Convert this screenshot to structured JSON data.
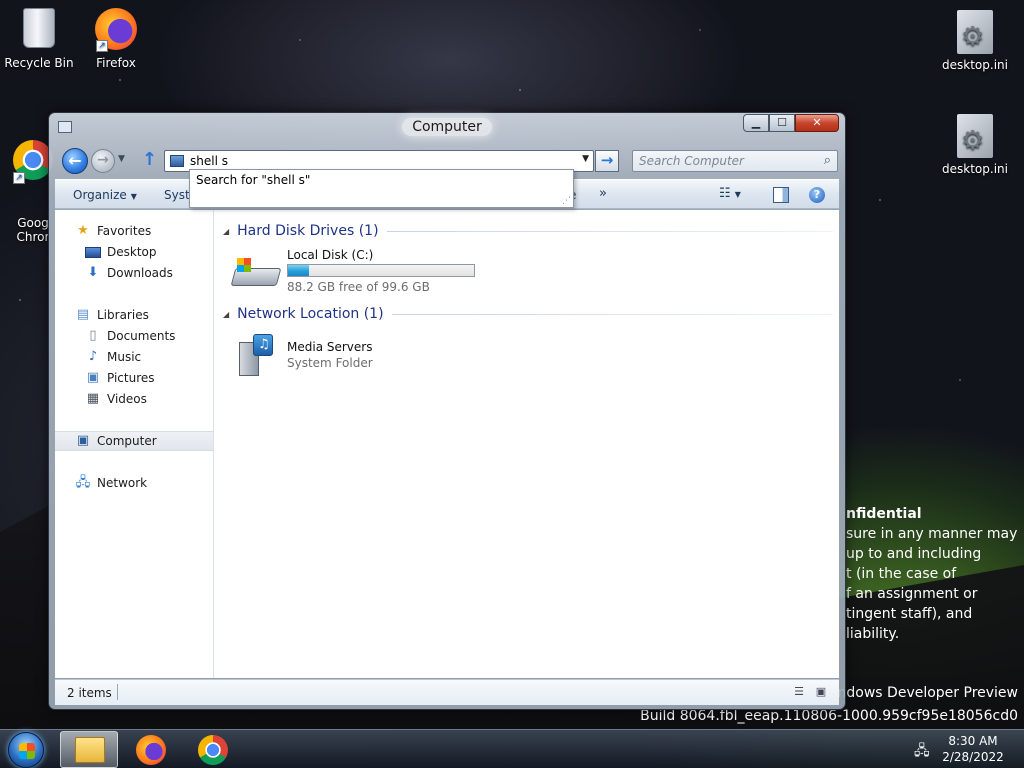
{
  "desktop": {
    "icons": [
      {
        "label": "Recycle Bin",
        "icon": "recycle-bin-icon"
      },
      {
        "label": "Firefox",
        "icon": "firefox-icon"
      },
      {
        "label": "Goog\nChror",
        "icon": "chrome-icon"
      },
      {
        "label": "desktop.ini",
        "icon": "settings-file-icon"
      },
      {
        "label": "desktop.ini",
        "icon": "settings-file-icon"
      }
    ],
    "watermark": {
      "title": "nfidential",
      "lines": [
        "sure in any manner may",
        "up to and including",
        "t (in the case of",
        "f an assignment or",
        "tingent staff), and",
        "liability."
      ],
      "edition": "ndows Developer Preview",
      "build": "Build 8064.fbl_eeap.110806-1000.959cf95e18056cd0"
    }
  },
  "window": {
    "title": "Computer",
    "address": {
      "value": "shell s"
    },
    "search": {
      "placeholder": "Search Computer"
    },
    "suggestion": "Search for \"shell s\"",
    "toolbar": {
      "organize": "Organize",
      "system": "Syste",
      "truncated": "e",
      "overflow": "»"
    },
    "nav": {
      "favorites": "Favorites",
      "desktop": "Desktop",
      "downloads": "Downloads",
      "libraries": "Libraries",
      "documents": "Documents",
      "music": "Music",
      "pictures": "Pictures",
      "videos": "Videos",
      "computer": "Computer",
      "network": "Network"
    },
    "groups": [
      {
        "header": "Hard Disk Drives (1)",
        "items": [
          {
            "name": "Local Disk (C:)",
            "sub": "88.2 GB free of 99.6 GB",
            "used_fraction": 0.114
          }
        ]
      },
      {
        "header": "Network Location (1)",
        "items": [
          {
            "name": "Media Servers",
            "sub": "System Folder"
          }
        ]
      }
    ],
    "status": {
      "count": "2 items"
    }
  },
  "taskbar": {
    "time": "8:30 AM",
    "date": "2/28/2022"
  },
  "colors": {
    "accent": "#26a0da",
    "group_header": "#1e3287",
    "close_button": "#c8452c"
  }
}
